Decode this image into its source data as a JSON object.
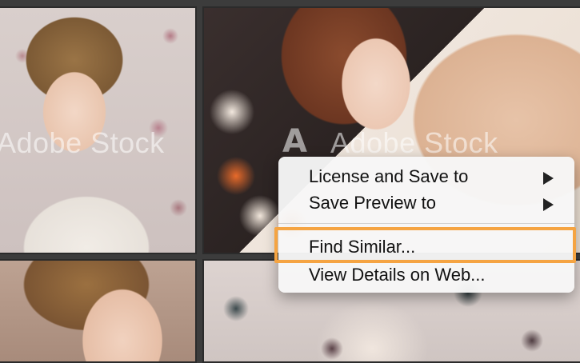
{
  "watermark": {
    "left_text": "Adobe Stock",
    "right_text": "Adobe Stock",
    "logo_glyph": "A"
  },
  "photos": [
    {
      "name": "portrait-floral-wallpaper"
    },
    {
      "name": "portrait-lying-floral-fabric"
    },
    {
      "name": "portrait-bottom-left"
    },
    {
      "name": "floral-wallpaper-bottom-right"
    }
  ],
  "context_menu": {
    "items": [
      {
        "label": "License and Save to",
        "has_submenu": true
      },
      {
        "label": "Save Preview to",
        "has_submenu": true
      },
      {
        "label": "Find Similar...",
        "has_submenu": false,
        "highlighted": true
      },
      {
        "label": "View Details on Web...",
        "has_submenu": false
      }
    ]
  },
  "colors": {
    "highlight": "#f5a442",
    "grid_background": "#3c3c3c"
  },
  "icons": {
    "submenu_arrow": "chevron-right-icon"
  }
}
